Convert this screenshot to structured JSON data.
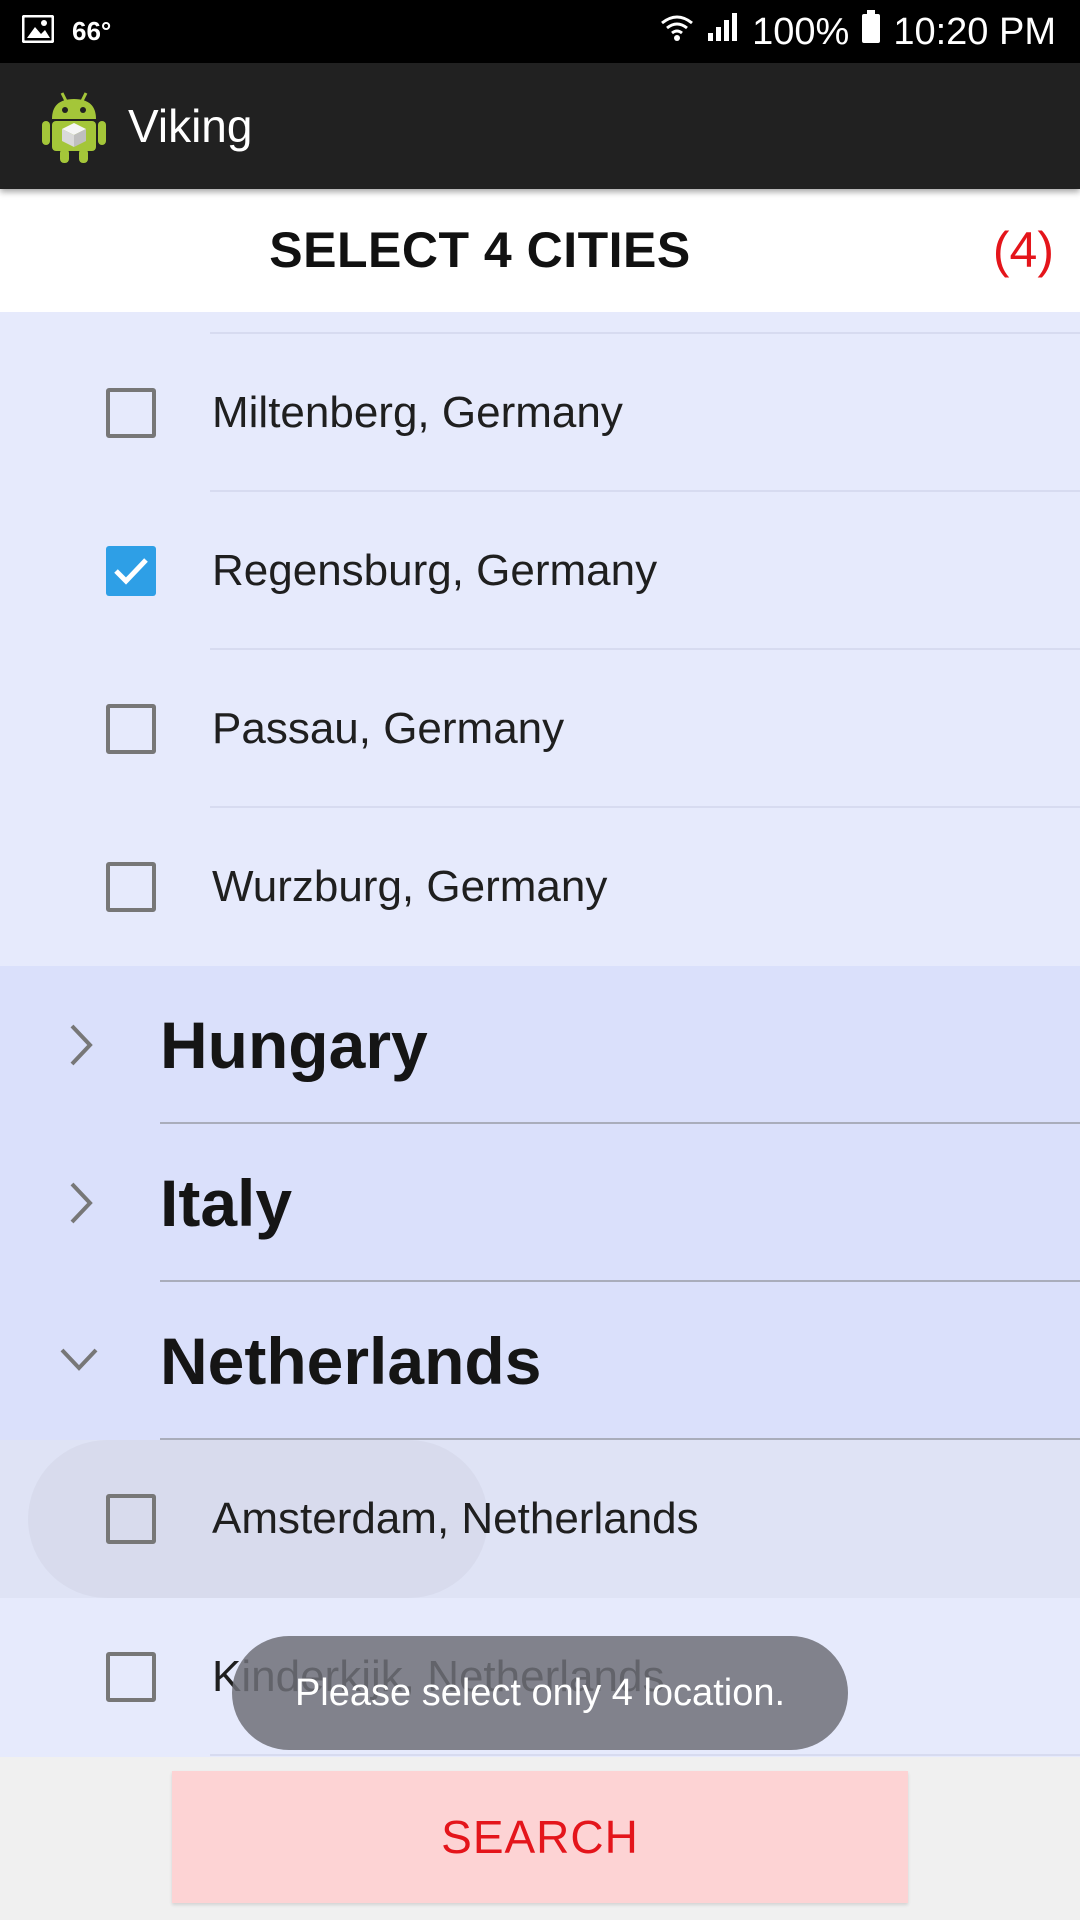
{
  "status_bar": {
    "temperature": "66°",
    "battery_percent": "100%",
    "time": "10:20 PM",
    "icons": [
      "image-icon",
      "wifi-icon",
      "cell-signal-icon",
      "battery-icon"
    ]
  },
  "app_bar": {
    "title": "Viking",
    "logo_icon": "android-robot-icon"
  },
  "header": {
    "title": "SELECT 4 CITIES",
    "count": "(4)"
  },
  "list": {
    "cities_before": [
      {
        "label": "Miltenberg, Germany",
        "checked": false
      },
      {
        "label": "Regensburg, Germany",
        "checked": true
      },
      {
        "label": "Passau, Germany",
        "checked": false
      },
      {
        "label": "Wurzburg, Germany",
        "checked": false
      }
    ],
    "groups": [
      {
        "label": "Hungary",
        "expanded": false
      },
      {
        "label": "Italy",
        "expanded": false
      },
      {
        "label": "Netherlands",
        "expanded": true
      }
    ],
    "cities_after": [
      {
        "label": "Amsterdam, Netherlands",
        "checked": false,
        "pressed": true
      },
      {
        "label": "Kinderkijk, Netherlands",
        "checked": false
      }
    ]
  },
  "toast": {
    "message": "Please select only 4 location."
  },
  "footer": {
    "search_label": "SEARCH"
  },
  "colors": {
    "accent_red": "#e4151b",
    "checkbox_checked": "#2e9fe6",
    "list_background": "#e6eafc",
    "group_background": "#dae0fb",
    "search_button_background": "#fdd3d4"
  }
}
